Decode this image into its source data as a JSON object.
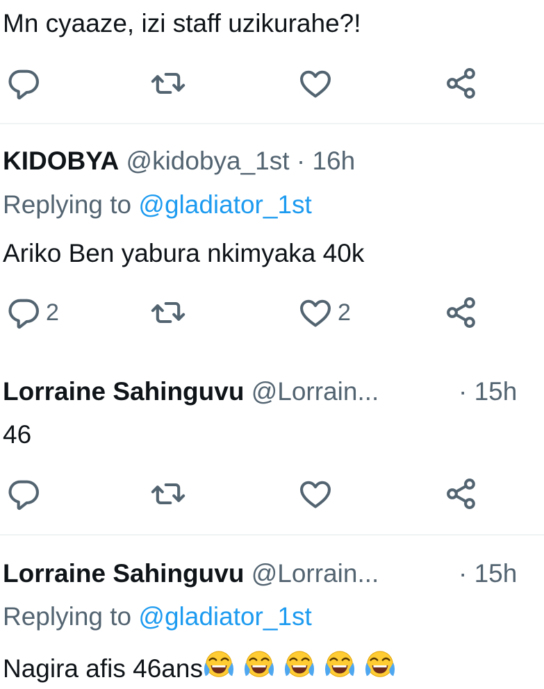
{
  "tweets": [
    {
      "text": "Mn cyaaze, izi staff uzikurahe?!",
      "reply_count": "",
      "like_count": ""
    },
    {
      "name": "KIDOBYA",
      "handle": "@kidobya_1st",
      "separator": "·",
      "time": "16h",
      "replying_prefix": "Replying to",
      "replying_to": "@gladiator_1st",
      "text": "Ariko Ben yabura nkimyaka 40k",
      "reply_count": "2",
      "like_count": "2"
    },
    {
      "name": "Lorraine Sahinguvu",
      "handle": "@Lorrain...",
      "separator": "·",
      "time": "15h",
      "text": "46",
      "reply_count": "",
      "like_count": ""
    },
    {
      "name": "Lorraine Sahinguvu",
      "handle": "@Lorrain...",
      "separator": "·",
      "time": "15h",
      "replying_prefix": "Replying to",
      "replying_to": "@gladiator_1st",
      "text": "Nagira afis 46ans",
      "emojis": [
        "face-with-tears-of-joy",
        "face-with-tears-of-joy",
        "face-with-tears-of-joy",
        "face-with-tears-of-joy",
        "face-with-tears-of-joy"
      ]
    }
  ],
  "icons": {
    "reply": "reply-icon",
    "retweet": "retweet-icon",
    "like": "heart-icon",
    "share": "share-icon"
  },
  "colors": {
    "text": "#0f1419",
    "secondary": "#536471",
    "link": "#1d9bf0",
    "divider": "#eff3f4"
  }
}
